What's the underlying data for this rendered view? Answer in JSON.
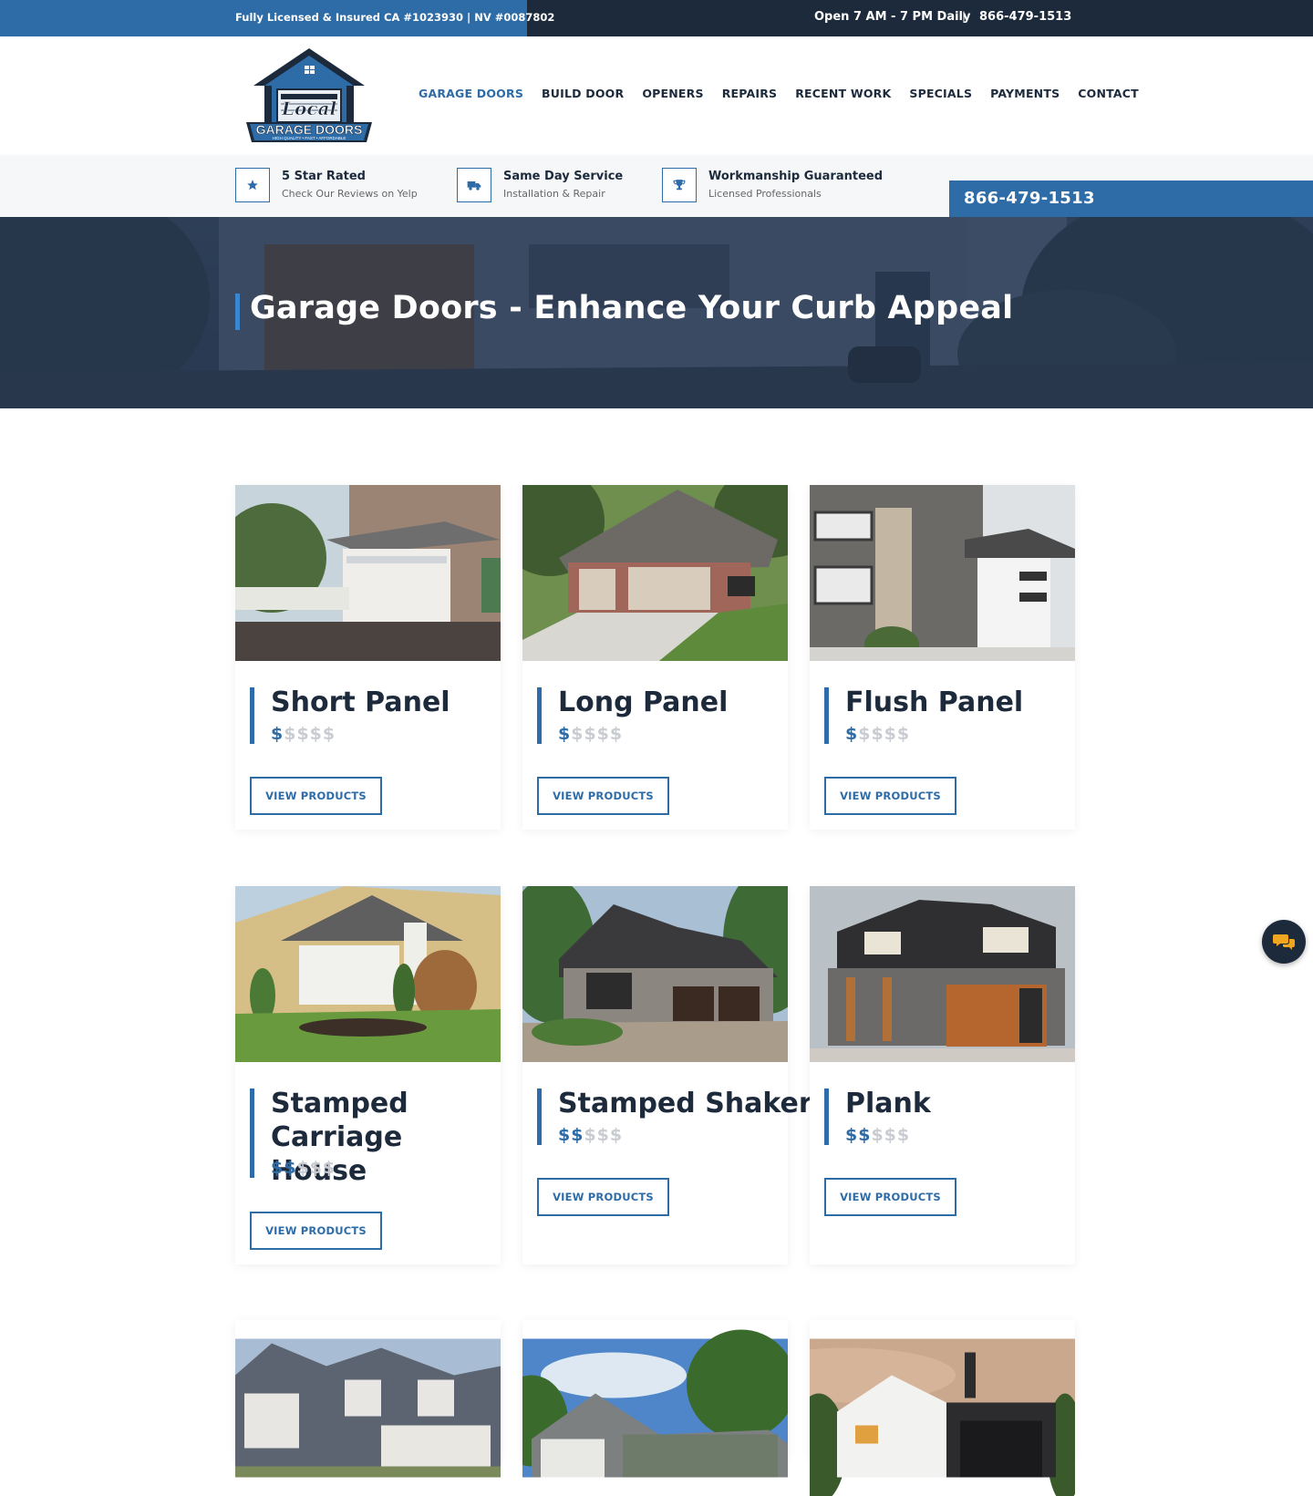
{
  "topbar": {
    "license": "Fully Licensed & Insured CA #1023930 | NV #0087802",
    "hours": "Open 7 AM - 7 PM Daily",
    "separator": "|",
    "phone": "866-479-1513"
  },
  "logo": {
    "line1": "Local",
    "line2": "GARAGE DOORS",
    "tagline": "HIGH QUALITY • FAST • AFFORDABLE"
  },
  "nav": {
    "items": [
      "GARAGE DOORS",
      "BUILD DOOR",
      "OPENERS",
      "REPAIRS",
      "RECENT WORK",
      "SPECIALS",
      "PAYMENTS",
      "CONTACT"
    ],
    "active": "GARAGE DOORS"
  },
  "features": [
    {
      "icon": "star-icon",
      "title": "5 Star Rated",
      "subtitle": "Check Our Reviews on Yelp"
    },
    {
      "icon": "truck-icon",
      "title": "Same Day Service",
      "subtitle": "Installation & Repair"
    },
    {
      "icon": "trophy-icon",
      "title": "Workmanship Guaranteed",
      "subtitle": "Licensed Professionals"
    }
  ],
  "phone_box": "866-479-1513",
  "hero": {
    "title": "Garage Doors - Enhance Your Curb Appeal"
  },
  "cards": [
    {
      "title": "Short Panel",
      "price_on": "$",
      "price_off": "$$$$",
      "button": "VIEW PRODUCTS"
    },
    {
      "title": "Long Panel",
      "price_on": "$",
      "price_off": "$$$$",
      "button": "VIEW PRODUCTS"
    },
    {
      "title": "Flush Panel",
      "price_on": "$",
      "price_off": "$$$$",
      "button": "VIEW PRODUCTS"
    },
    {
      "title": "Stamped Carriage House",
      "price_on": "$$",
      "price_off": "$$$",
      "button": "VIEW PRODUCTS"
    },
    {
      "title": "Stamped Shaker",
      "price_on": "$$",
      "price_off": "$$$",
      "button": "VIEW PRODUCTS"
    },
    {
      "title": "Plank",
      "price_on": "$$",
      "price_off": "$$$",
      "button": "VIEW PRODUCTS"
    }
  ],
  "colors": {
    "brand_blue": "#2e6ca8",
    "navy": "#1c2a3c",
    "price_inactive": "#c9ccd1"
  },
  "chat_icon": "chat-icon"
}
